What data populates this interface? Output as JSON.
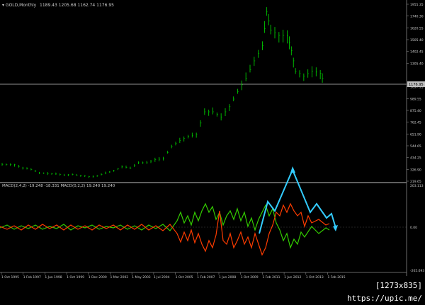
{
  "window": {
    "title": "GOLD,Monthly",
    "ohlc": "1189.43 1205.68 1162.74 1176.95"
  },
  "indicator": {
    "label": "MACD(2,4,2) -19.248 -18.331  MACD(0,2,2) 19.240 19.240"
  },
  "price_axis": {
    "labels": [
      "1955.35",
      "1740.30",
      "1620.55",
      "1505.40",
      "1402.45",
      "1305.40",
      "1176.95",
      "1097.95",
      "989.55",
      "875.40",
      "762.45",
      "651.90",
      "544.65",
      "434.25",
      "326.90",
      "219.65"
    ],
    "current": "1176.95"
  },
  "indicator_axis": {
    "labels": [
      "203.113",
      "0.00",
      "-205.693"
    ]
  },
  "time_axis": {
    "labels": [
      "1 Oct 1995",
      "1 Feb 1997",
      "1 Jun 1998",
      "1 Oct 1999",
      "1 Dec 2000",
      "1 Mar 2002",
      "1 May 2003",
      "1 Jul 2004",
      "1 Oct 2005",
      "1 Feb 2007",
      "1 Jun 2008",
      "1 Oct 2009",
      "1 Feb 2011",
      "1 Jun 2012",
      "1 Oct 2013",
      "1 Feb 2015"
    ]
  },
  "watermark": "[1273x835] https://upic.me/",
  "colors": {
    "background": "#000000",
    "candles": "#00c800",
    "macd_main": "#ff3c00",
    "macd_signal": "#33cc00",
    "annotation": "#33ccff",
    "grid_line": "#bfbfbf",
    "text": "#cccccc"
  },
  "chart_data": {
    "type": "line",
    "title": "GOLD,Monthly",
    "price_series": {
      "name": "GOLD,Monthly",
      "x": [
        1995.75,
        1996.5,
        1997,
        1997.5,
        1998,
        1998.5,
        1999,
        1999.5,
        2000,
        2000.5,
        2001,
        2001.5,
        2002,
        2002.5,
        2003,
        2003.5,
        2004,
        2004.5,
        2005,
        2005.5,
        2006,
        2006.5,
        2007,
        2007.5,
        2008,
        2008.5,
        2009,
        2009.5,
        2010,
        2010.5,
        2011,
        2011.5,
        2011.75,
        2012,
        2012.5,
        2013,
        2013.25,
        2013.5,
        2014,
        2014.5,
        2015,
        2015.25
      ],
      "y": [
        385,
        380,
        350,
        335,
        300,
        295,
        290,
        280,
        285,
        275,
        265,
        270,
        300,
        320,
        360,
        350,
        400,
        400,
        430,
        440,
        560,
        620,
        660,
        680,
        900,
        900,
        850,
        950,
        1100,
        1230,
        1400,
        1550,
        1880,
        1700,
        1650,
        1650,
        1500,
        1300,
        1250,
        1300,
        1280,
        1177
      ]
    },
    "ylim": [
      219.65,
      1955.35
    ],
    "indicator_ylim": [
      -205.693,
      203.113
    ]
  }
}
